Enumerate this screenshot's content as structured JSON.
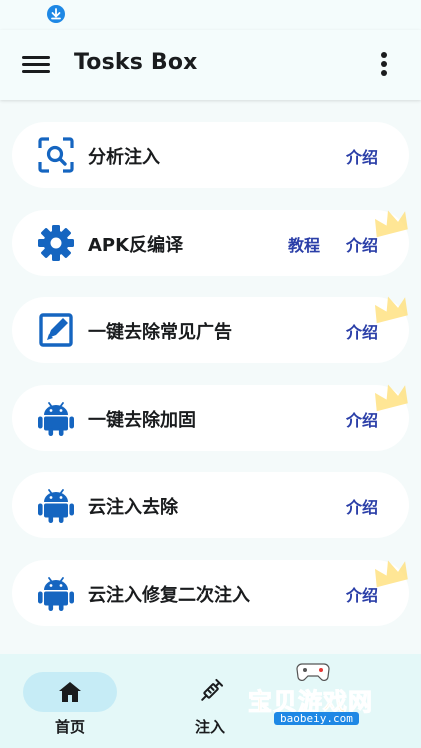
{
  "app_bar": {
    "title": "Tosks Box"
  },
  "cards": [
    {
      "label": "分析注入",
      "icon": "scan-search-icon",
      "links": [
        "介绍"
      ]
    },
    {
      "label": "APK反编译",
      "icon": "gear-icon",
      "links": [
        "教程",
        "介绍"
      ]
    },
    {
      "label": "一键去除常见广告",
      "icon": "edit-box-icon",
      "links": [
        "介绍"
      ]
    },
    {
      "label": "一键去除加固",
      "icon": "android-icon",
      "links": [
        "介绍"
      ]
    },
    {
      "label": "云注入去除",
      "icon": "android-icon",
      "links": [
        "介绍"
      ]
    },
    {
      "label": "云注入修复二次注入",
      "icon": "android-icon",
      "links": [
        "介绍"
      ]
    }
  ],
  "bottom_nav": [
    {
      "label": "首页",
      "icon": "home-icon",
      "selected": true
    },
    {
      "label": "注入",
      "icon": "syringe-icon",
      "selected": false
    }
  ],
  "watermark": {
    "text": "宝贝游戏网",
    "domain": "baobeiy.com"
  },
  "colors": {
    "primary": "#2b3fa8",
    "icon_blue": "#1565c0",
    "background": "#f4fafa",
    "nav_background": "#e4f8f8",
    "selected_pill": "#c6ecf6"
  }
}
